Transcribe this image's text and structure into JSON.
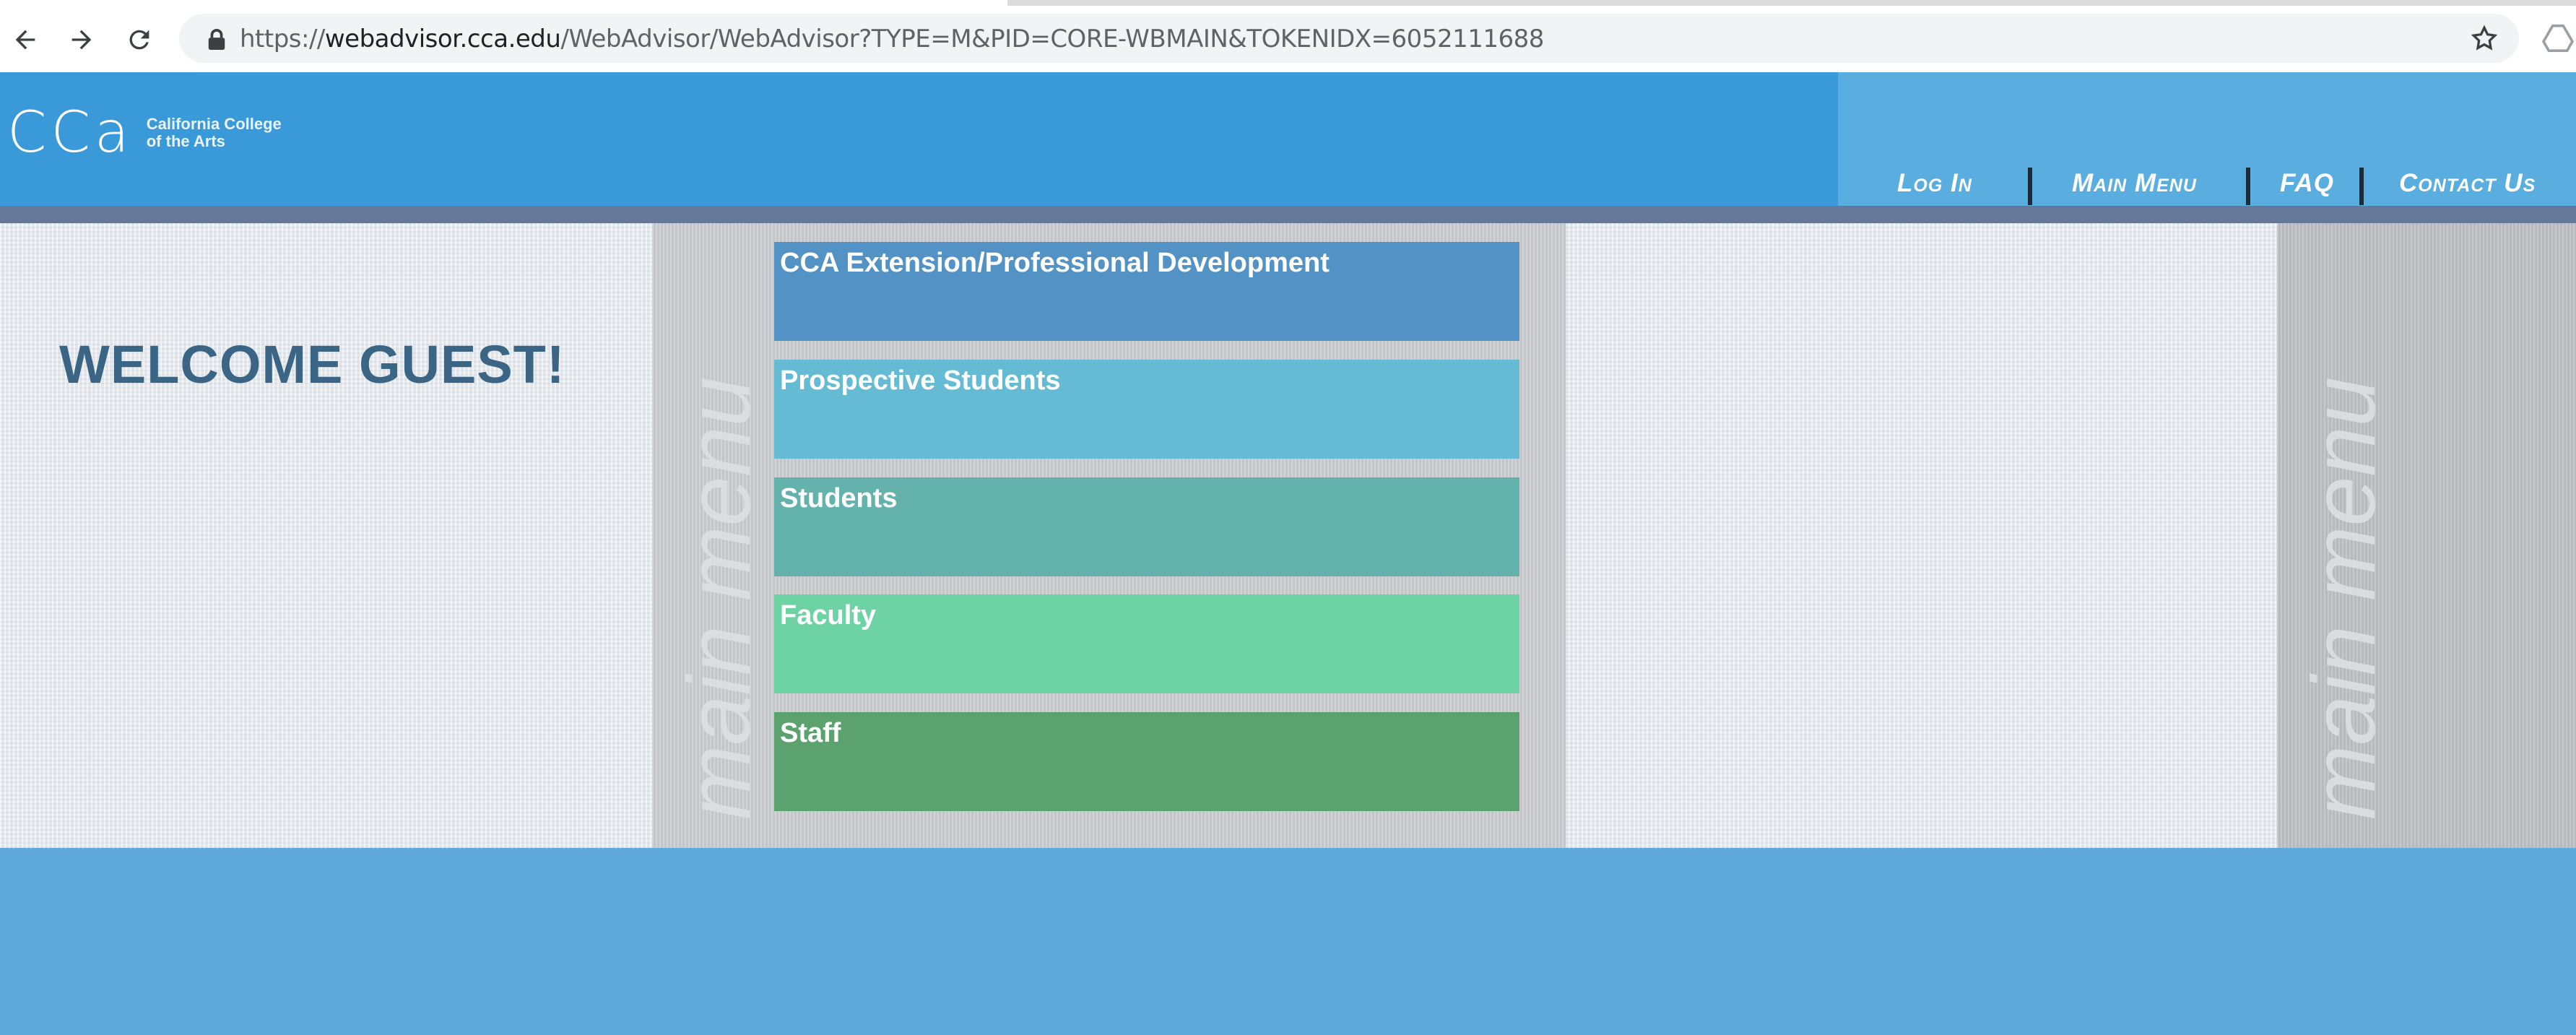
{
  "browser": {
    "url_prefix": "https://",
    "url_host": "webadvisor.cca.edu",
    "url_path": "/WebAdvisor/WebAdvisor?TYPE=M&PID=CORE-WBMAIN&TOKENIDX=6052111688",
    "icons": [
      "back-icon",
      "forward-icon",
      "reload-icon",
      "lock-icon",
      "star-icon",
      "drive-icon"
    ]
  },
  "header": {
    "logo_mark": "CCa",
    "logo_line1": "California College",
    "logo_line2": "of the Arts",
    "nav": {
      "login": "Log In",
      "main_menu": "Main Menu",
      "faq": "FAQ",
      "contact": "Contact Us"
    }
  },
  "main": {
    "welcome": "WELCOME GUEST!",
    "panel_label": "main menu",
    "menu_items": [
      {
        "label": "CCA Extension/Professional Development",
        "color": "#5292c4"
      },
      {
        "label": "Prospective Students",
        "color": "#65bbd3"
      },
      {
        "label": "Students",
        "color": "#63b3ac"
      },
      {
        "label": "Faculty",
        "color": "#6dd3a4"
      },
      {
        "label": "Staff",
        "color": "#5ba26f"
      }
    ]
  },
  "colors": {
    "header": "#3a9ad9",
    "header_right": "#5aaedf",
    "divider_bar": "#66789a",
    "footer": "#5fa9dc",
    "welcome_text": "#3a6585"
  }
}
